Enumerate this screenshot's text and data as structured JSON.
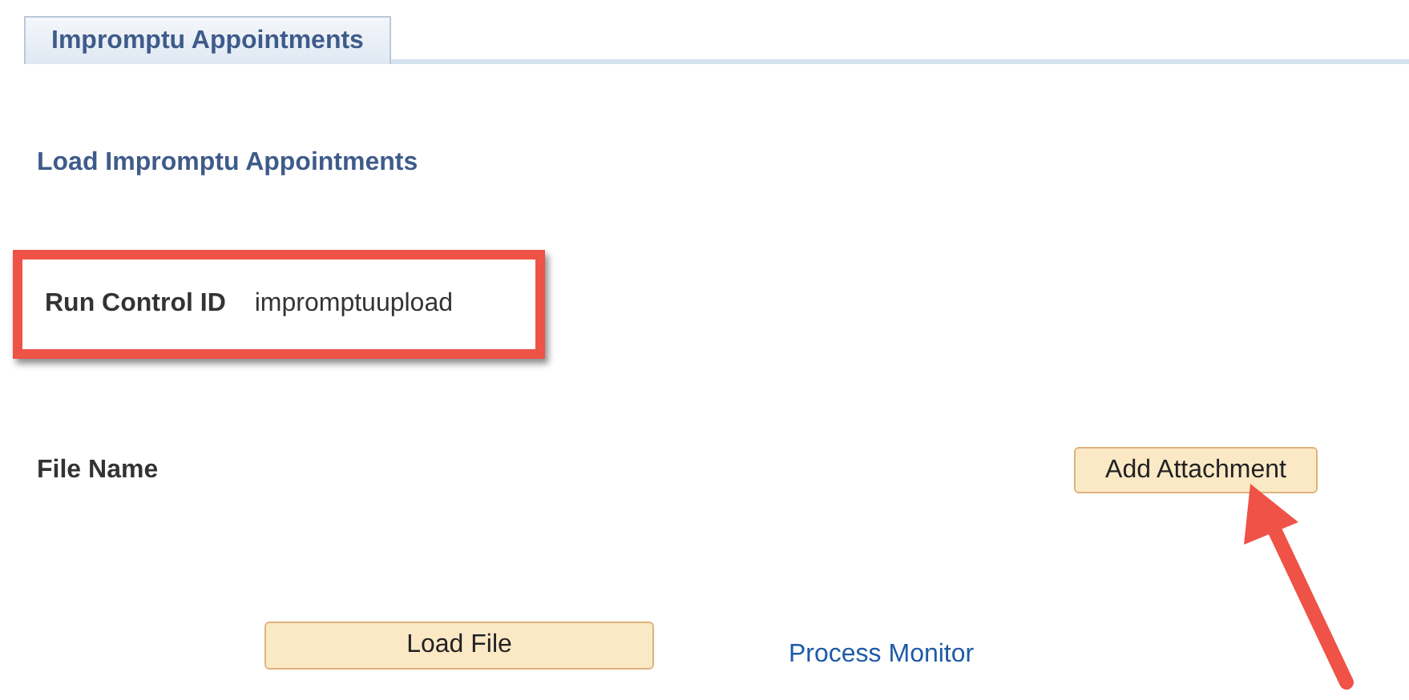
{
  "tabs": [
    {
      "label": "Impromptu Appointments",
      "selected": true
    }
  ],
  "heading": "Load Impromptu Appointments",
  "run_control": {
    "label": "Run Control ID",
    "value": "impromptuupload",
    "highlighted": true
  },
  "file_name": {
    "label": "File Name",
    "button": "Add Attachment",
    "arrow": true
  },
  "load_button": "Load File",
  "link": "Process Monitor"
}
